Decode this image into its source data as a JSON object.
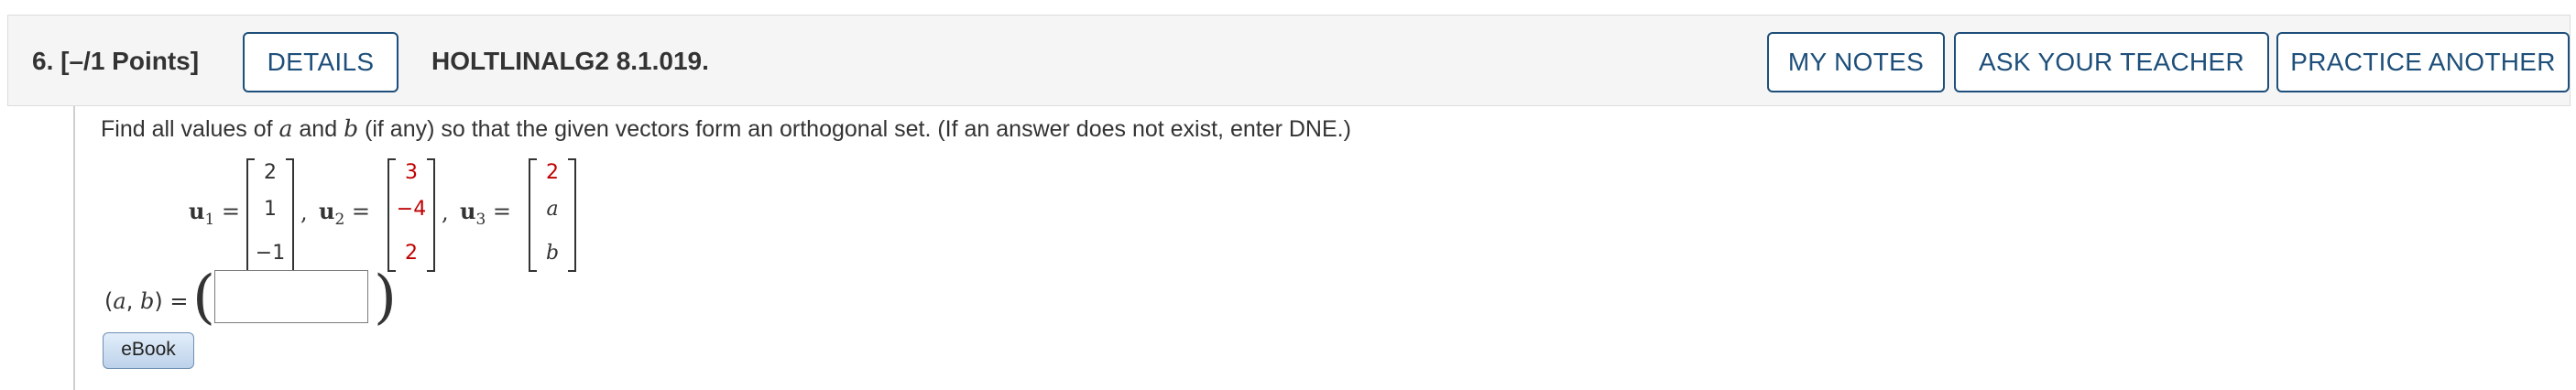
{
  "question": {
    "number": "6.",
    "points": "[–/1 Points]",
    "id": "HOLTLINALG2 8.1.019."
  },
  "buttons": {
    "details": "DETAILS",
    "my_notes": "MY NOTES",
    "ask_teacher": "ASK YOUR TEACHER",
    "practice_another": "PRACTICE ANOTHER"
  },
  "prompt": {
    "p1": "Find all values of ",
    "var_a": "a",
    "p2": " and ",
    "var_b": "b",
    "p3": " (if any) so that the given vectors form an orthogonal set. (If an answer does not exist, enter DNE.)"
  },
  "vectors": [
    {
      "name": "u",
      "sub": "1",
      "entries": [
        "2",
        "1",
        "−1"
      ]
    },
    {
      "name": "u",
      "sub": "2",
      "entries": [
        "3",
        "−4",
        "2"
      ]
    },
    {
      "name": "u",
      "sub": "3",
      "entries": [
        "2",
        "a",
        "b"
      ]
    }
  ],
  "equals": "=",
  "comma": ",",
  "answer": {
    "label_open": "(",
    "label_a": "a",
    "label_comma": ", ",
    "label_b": "b",
    "label_close": ") =",
    "paren_left": "(",
    "paren_right": ")",
    "value": ""
  },
  "ebook_label": "eBook",
  "colors": {
    "accent": "#1e4f7a",
    "highlight_red": "#c00000",
    "header_bg": "#f5f5f5"
  }
}
